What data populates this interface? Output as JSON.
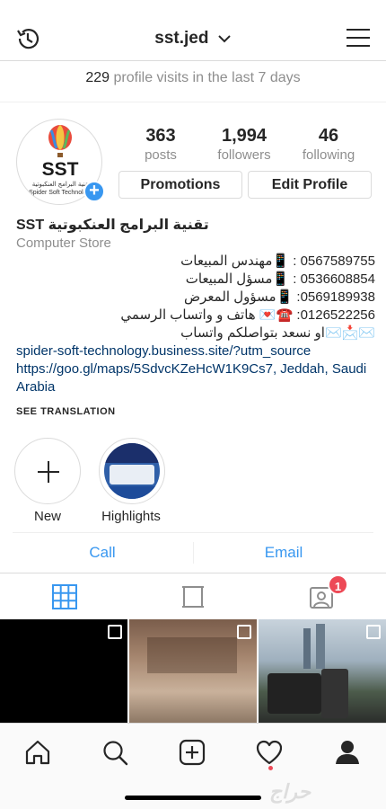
{
  "header": {
    "username": "sst.jed"
  },
  "insights": {
    "count": "229",
    "text": " profile visits in the last 7 days"
  },
  "avatar": {
    "logo_text": "SST",
    "logo_sub": "تقنية البرامج العنكبوتية Spider Soft Technology"
  },
  "stats": [
    {
      "value": "363",
      "label": "posts"
    },
    {
      "value": "1,994",
      "label": "followers"
    },
    {
      "value": "46",
      "label": "following"
    }
  ],
  "buttons": {
    "promotions": "Promotions",
    "edit_profile": "Edit Profile"
  },
  "bio": {
    "name": "تقنية البرامج العنكبوتية SST",
    "category": "Computer Store",
    "lines": [
      "0567589755 : 📱مهندس المبيعات",
      "0536608854 : 📱مسؤل المبيعات",
      "0569189938: 📱مسؤول المعرض",
      "0126522256: ☎️💌 هاتف و واتساب الرسمي",
      "✉️📩✉️او نسعد بتواصلكم واتساب"
    ],
    "website": "spider-soft-technology.business.site/?utm_source",
    "map_link": "https://goo.gl/maps/5SdvcKZeHcW1K9Cs7, Jeddah, Saudi",
    "map_link_cont": "Arabia",
    "see_translation": "SEE TRANSLATION"
  },
  "highlights": [
    {
      "label": "New"
    },
    {
      "label": "Highlights"
    }
  ],
  "actions": {
    "call": "Call",
    "email": "Email"
  },
  "tabs": {
    "tagged_badge": "1"
  },
  "watermark": "حراج",
  "colors": {
    "accent": "#3897f0",
    "badge": "#ed4956",
    "link": "#003569"
  }
}
